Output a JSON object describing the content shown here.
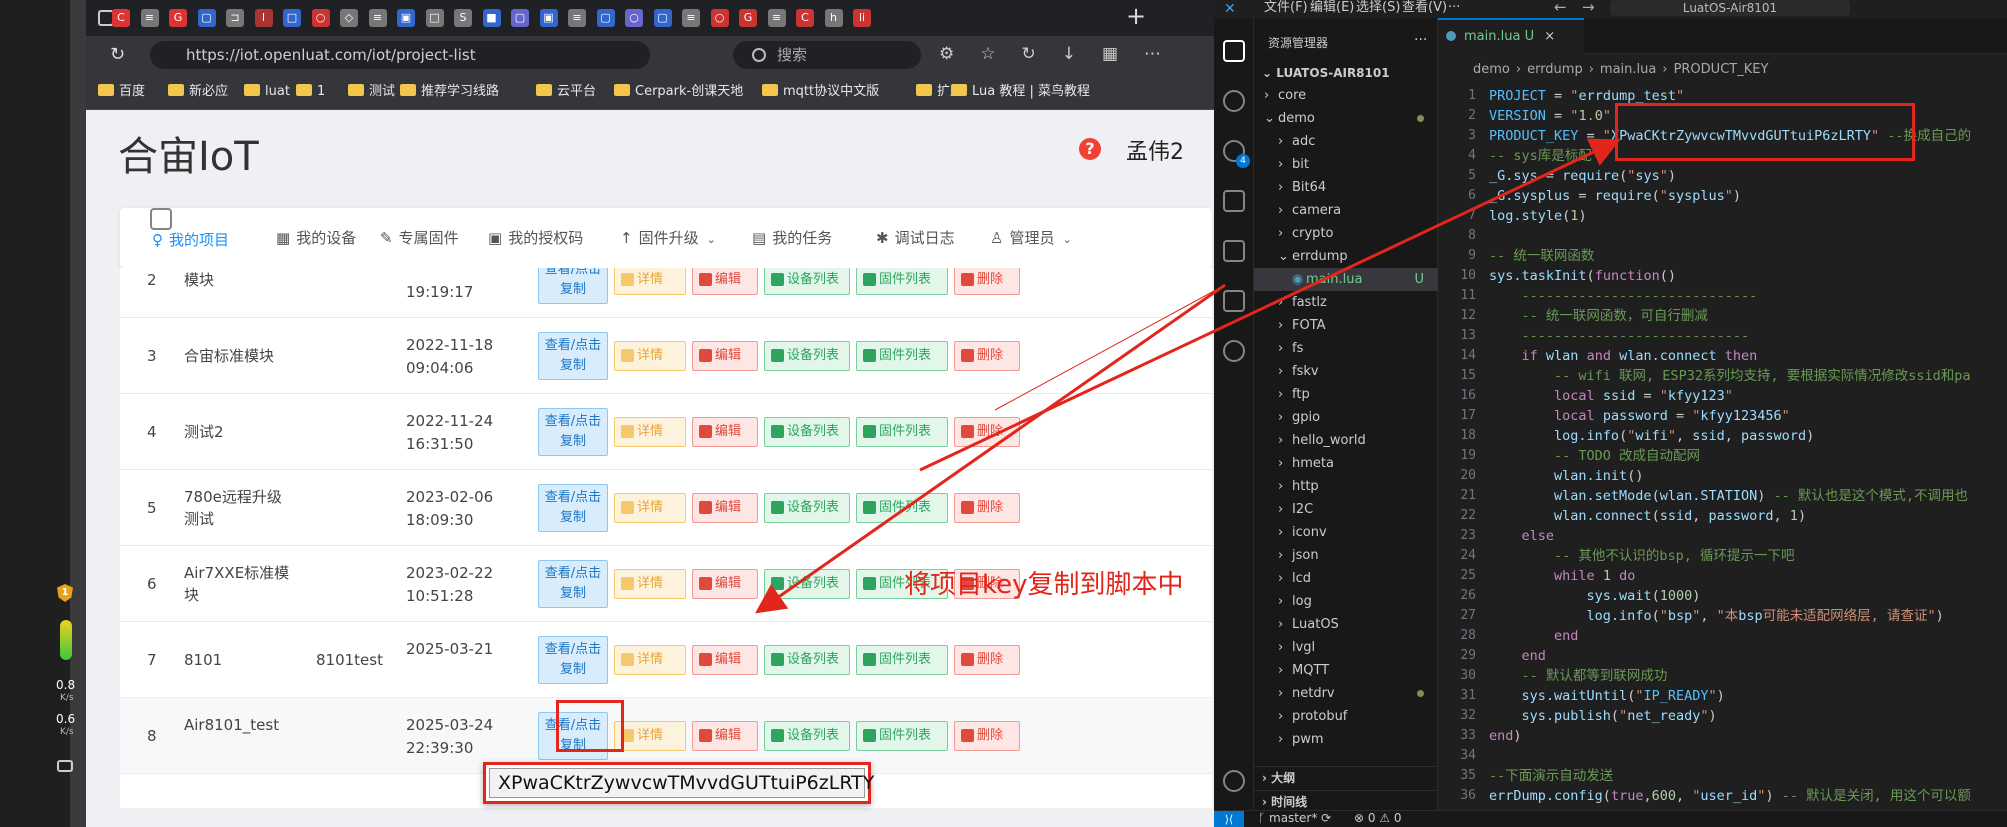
{
  "browser": {
    "url": "https://iot.openluat.com/iot/project-list",
    "search_placeholder": "搜索",
    "tab_glyphs": [
      "C",
      "≡",
      "G",
      "▢",
      "⊐",
      "l",
      "□",
      "○",
      "◇",
      "≡",
      "▣",
      "□",
      "S",
      "■",
      "▢",
      "▣",
      "≡",
      "▢",
      "○",
      "▢",
      "≡",
      "○",
      "G",
      "≡",
      "C",
      "h",
      "li"
    ],
    "bookmarks": [
      "百度",
      "新必应",
      "luat",
      "1",
      "测试",
      "推荐学习线路",
      "云平台",
      "Cerpark-创课天地",
      "mqtt协议中文版",
      "扩展",
      "Lua 教程 | 菜鸟教程"
    ]
  },
  "sidebar": {
    "down_rate": "0.8",
    "down_unit": "K/s",
    "up_rate": "0.6",
    "up_unit": "K/s",
    "badge": "1"
  },
  "page": {
    "brand": "合宙IoT",
    "user": "孟伟2",
    "nav": [
      "我的项目",
      "我的设备",
      "专属固件",
      "我的授权码",
      "固件升级",
      "我的任务",
      "调试日志",
      "管理员"
    ],
    "actions": {
      "view": "查看/点击复制",
      "detail": "详情",
      "edit": "编辑",
      "devices": "设备列表",
      "firmware": "固件列表",
      "delete": "删除"
    },
    "rows": [
      {
        "no": "2",
        "name": "模块",
        "extra": "",
        "date": "",
        "time": "19:19:17"
      },
      {
        "no": "3",
        "name": "合宙标准模块",
        "extra": "",
        "date": "2022-11-18",
        "time": "09:04:06"
      },
      {
        "no": "4",
        "name": "测试2",
        "extra": "",
        "date": "2022-11-24",
        "time": "16:31:50"
      },
      {
        "no": "5",
        "name": "780e远程升级测试",
        "extra": "",
        "date": "2023-02-06",
        "time": "18:09:30"
      },
      {
        "no": "6",
        "name": "Air7XXE标准模块",
        "extra": "",
        "date": "2023-02-22",
        "time": "10:51:28"
      },
      {
        "no": "7",
        "name": "8101",
        "extra": "8101test",
        "date": "2025-03-21",
        "time": ""
      },
      {
        "no": "8",
        "name": "Air8101_test",
        "extra": "",
        "date": "2025-03-24",
        "time": "22:39:30"
      }
    ],
    "copied_key": "XPwaCKtrZywvcwTMvvdGUTtuiP6zLRTY",
    "annotation": "将项目key复制到脚本中"
  },
  "vscode": {
    "menu": [
      "文件(F)",
      "编辑(E)",
      "选择(S)",
      "查看(V)",
      "···"
    ],
    "search": "LuatOS-Air8101",
    "explorer_title": "资源管理器",
    "root": "LUATOS-AIR8101",
    "tree": [
      {
        "label": "core",
        "depth": 1,
        "open": false
      },
      {
        "label": "demo",
        "depth": 1,
        "open": true,
        "dot": true
      },
      {
        "label": "adc",
        "depth": 2
      },
      {
        "label": "bit",
        "depth": 2
      },
      {
        "label": "Bit64",
        "depth": 2
      },
      {
        "label": "camera",
        "depth": 2
      },
      {
        "label": "crypto",
        "depth": 2
      },
      {
        "label": "errdump",
        "depth": 2,
        "open": true
      },
      {
        "label": "main.lua",
        "depth": 3,
        "file": true,
        "badge": "U"
      },
      {
        "label": "fastlz",
        "depth": 2
      },
      {
        "label": "FOTA",
        "depth": 2
      },
      {
        "label": "fs",
        "depth": 2
      },
      {
        "label": "fskv",
        "depth": 2
      },
      {
        "label": "ftp",
        "depth": 2
      },
      {
        "label": "gpio",
        "depth": 2
      },
      {
        "label": "hello_world",
        "depth": 2
      },
      {
        "label": "hmeta",
        "depth": 2
      },
      {
        "label": "http",
        "depth": 2
      },
      {
        "label": "I2C",
        "depth": 2
      },
      {
        "label": "iconv",
        "depth": 2
      },
      {
        "label": "json",
        "depth": 2
      },
      {
        "label": "lcd",
        "depth": 2
      },
      {
        "label": "log",
        "depth": 2
      },
      {
        "label": "LuatOS",
        "depth": 2
      },
      {
        "label": "lvgl",
        "depth": 2
      },
      {
        "label": "MQTT",
        "depth": 2
      },
      {
        "label": "netdrv",
        "depth": 2,
        "dot": true
      },
      {
        "label": "protobuf",
        "depth": 2
      },
      {
        "label": "pwm",
        "depth": 2
      }
    ],
    "outline": "大纲",
    "timeline": "时间线",
    "tab": "main.lua",
    "tab_badge": "U",
    "breadcrumb": [
      "demo",
      "errdump",
      "main.lua",
      "PRODUCT_KEY"
    ],
    "code": [
      "PROJECT = \"errdump_test\"",
      "VERSION = \"1.0\"",
      "PRODUCT_KEY = \"XPwaCKtrZywvcwTMvvdGUTtuiP6zLRTY\" --换成自己的",
      "-- sys库是标配",
      "_G.sys = require(\"sys\")",
      "_G.sysplus = require(\"sysplus\")",
      "log.style(1)",
      "",
      "-- 统一联网函数",
      "sys.taskInit(function()",
      "    -----------------------------",
      "    -- 统一联网函数，可自行删减",
      "    ----------------------------",
      "    if wlan and wlan.connect then",
      "        -- wifi 联网, ESP32系列均支持, 要根据实际情况修改ssid和pa",
      "        local ssid = \"kfyy123\"",
      "        local password = \"kfyy123456\"",
      "        log.info(\"wifi\", ssid, password)",
      "        -- TODO 改成自动配网",
      "        wlan.init()",
      "        wlan.setMode(wlan.STATION) -- 默认也是这个模式,不调用也",
      "        wlan.connect(ssid, password, 1)",
      "    else",
      "        -- 其他不认识的bsp, 循环提示一下吧",
      "        while 1 do",
      "            sys.wait(1000)",
      "            log.info(\"bsp\", \"本bsp可能未适配网络层, 请查证\")",
      "        end",
      "    end",
      "    -- 默认都等到联网成功",
      "    sys.waitUntil(\"IP_READY\")",
      "    sys.publish(\"net_ready\")",
      "end)",
      "",
      "--下面演示自动发送",
      "errDump.config(true,600, \"user_id\") -- 默认是关闭, 用这个可以额"
    ],
    "status": {
      "branch": "master*",
      "sync": "⟳",
      "errors": "⊗ 0",
      "warnings": "⚠ 0"
    }
  }
}
